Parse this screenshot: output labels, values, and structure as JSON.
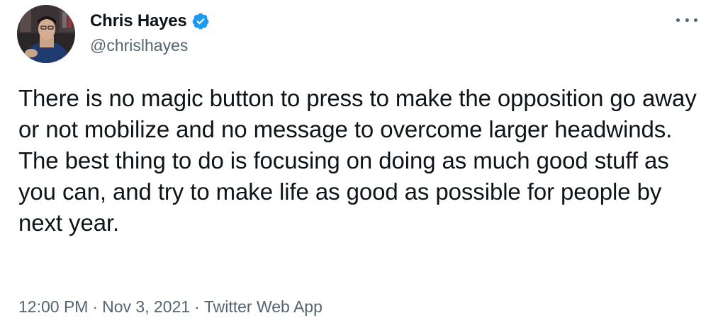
{
  "tweet": {
    "author": {
      "display_name": "Chris Hayes",
      "handle": "@chrislhayes",
      "verified": true,
      "avatar_icon": "profile-photo"
    },
    "more_icon": "ellipsis-icon",
    "text": "There is no magic button to press to make the opposition go away or not mobilize and no message to overcome larger headwinds. The best thing to do is focusing on doing as much good stuff as you can, and try to make life as good as possible for people by next year.",
    "meta": {
      "time": "12:00 PM",
      "separator": "·",
      "date": "Nov 3, 2021",
      "source": "Twitter Web App"
    },
    "colors": {
      "primary_text": "#0f1419",
      "secondary_text": "#536471",
      "verified_badge": "#1d9bf0",
      "background": "#ffffff"
    }
  }
}
